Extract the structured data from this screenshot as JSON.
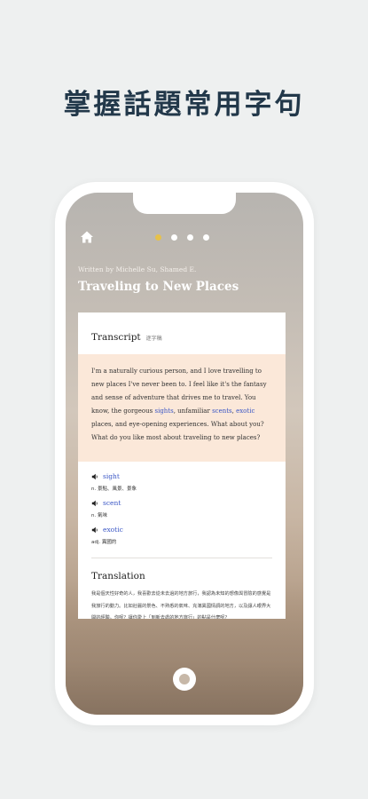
{
  "headline": "掌握話題常用字句",
  "screen": {
    "author": "Written by Michelle Su, Shamed E.",
    "title": "Traveling to New Places",
    "pager": {
      "count": 4,
      "active": 1
    }
  },
  "card": {
    "transcript_title": "Transcript",
    "transcript_sub": "逐字稿",
    "passage": {
      "p1": "I'm a naturally curious person, and I love travelling to new places I've never been to. I feel like it's the fantasy and sense of adventure that drives me to travel. You know, the gorgeous ",
      "w1": "sights",
      "p2": ", unfamiliar ",
      "w2": "scents",
      "p3": ", ",
      "w3": "exotic",
      "p4": " places, and eye-opening experiences. What about you? What do you like most about traveling to new places?"
    },
    "vocab": [
      {
        "word": "sight",
        "definition": "n. 景點、風景、景象"
      },
      {
        "word": "scent",
        "definition": "n. 氣味"
      },
      {
        "word": "exotic",
        "definition": "adj. 異國的"
      }
    ],
    "translation_title": "Translation",
    "translation_body": "我是個天性好奇的人，我喜歡去從未去過的地方旅行，我認為未知的想像與冒險的感覺是我旅行的動力。比如壯麗的景色、不熟悉的氣味、充滿異國情調的地方，以及讓人眼界大開的經驗。你呢？讓你愛上「到新去處的地方旅行」的點是什麼呢？"
  },
  "icons": {
    "home": "home-icon",
    "speaker": "speaker-icon",
    "record": "record-button-icon"
  },
  "colors": {
    "accent_link": "#3a56c5",
    "passage_bg": "#fbe8d9",
    "active_dot": "#e6c14a",
    "headline": "#22384a"
  }
}
